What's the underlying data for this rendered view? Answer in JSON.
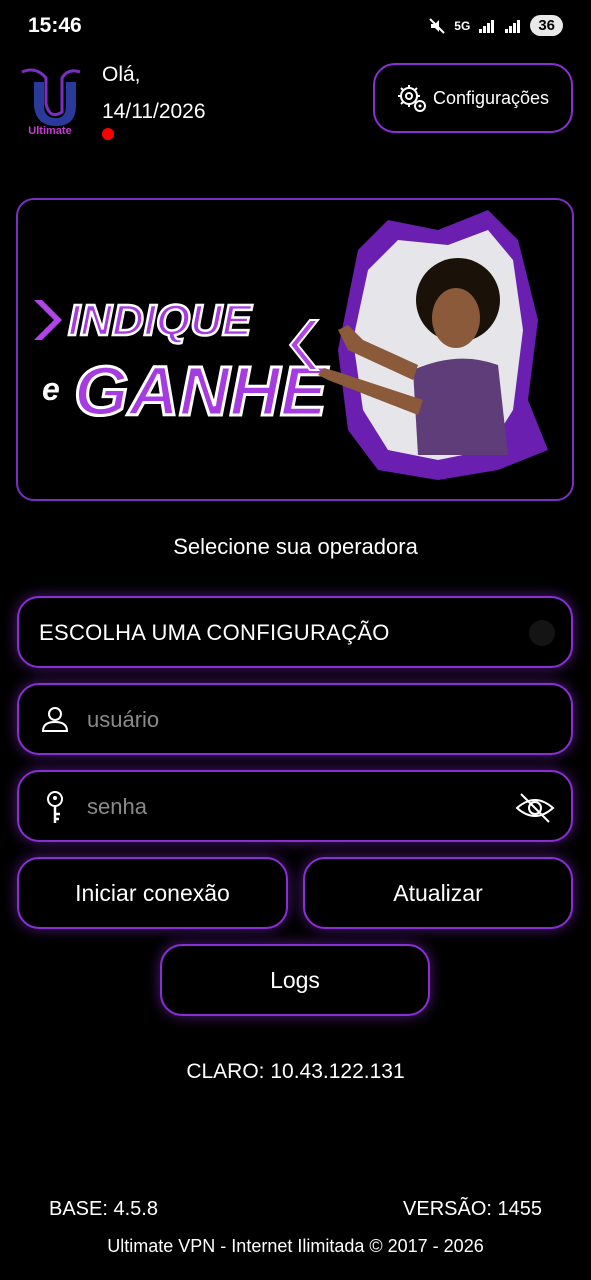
{
  "status_bar": {
    "time": "15:46",
    "network": "5G",
    "battery": "36"
  },
  "header": {
    "logo_text": "Ultimate",
    "greeting": "Olá,",
    "date": "14/11/2026",
    "config_button": "Configurações"
  },
  "banner": {
    "line1": "INDIQUE",
    "line2_small": "e",
    "line2": "GANHE"
  },
  "form": {
    "title": "Selecione sua operadora",
    "config_select": "ESCOLHA UMA CONFIGURAÇÃO",
    "username_placeholder": "usuário",
    "password_placeholder": "senha"
  },
  "buttons": {
    "connect": "Iniciar conexão",
    "update": "Atualizar",
    "logs": "Logs"
  },
  "info": {
    "ip": "CLARO: 10.43.122.131",
    "base": "BASE: 4.5.8",
    "version": "VERSÃO: 1455",
    "footer": "Ultimate VPN - Internet Ilimitada © 2017 - 2026"
  },
  "colors": {
    "accent": "#8a2ed6",
    "background": "#000000",
    "status_dot": "#ff0000"
  }
}
